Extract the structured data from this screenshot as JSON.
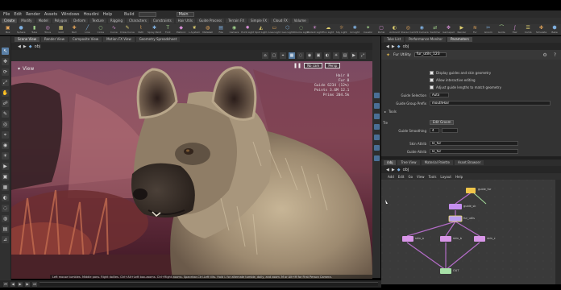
{
  "menubar": {
    "items": [
      "File",
      "Edit",
      "Render",
      "Assets",
      "Windows",
      "Houdini",
      "Help"
    ],
    "build_label": "Build",
    "main_label": "Main"
  },
  "shelf_tabs": [
    "Create",
    "Modify",
    "Model",
    "Polygon",
    "Deform",
    "Texture",
    "Rigging",
    "Characters",
    "Constraints",
    "Hair Utils",
    "Guide Process",
    "Terrain FX",
    "Simple FX",
    "Cloud FX",
    "Volume"
  ],
  "shelf_tools": [
    {
      "icon": "box-icon",
      "glyph": "▣",
      "label": "Box"
    },
    {
      "icon": "sphere-icon",
      "glyph": "●",
      "label": "Sphere"
    },
    {
      "icon": "tube-icon",
      "glyph": "▮",
      "label": "Tube"
    },
    {
      "icon": "torus-icon",
      "glyph": "◎",
      "label": "Torus"
    },
    {
      "icon": "grid-icon",
      "glyph": "▦",
      "label": "Grid"
    },
    {
      "icon": "null-icon",
      "glyph": "✚",
      "label": "Null"
    },
    {
      "icon": "line-icon",
      "glyph": "╱",
      "label": "Line"
    },
    {
      "icon": "circle-icon",
      "glyph": "○",
      "label": "Circle"
    },
    {
      "icon": "curve-icon",
      "glyph": "∿",
      "label": "Curve"
    },
    {
      "icon": "draw-curve-icon",
      "glyph": "✎",
      "label": "Draw Curve"
    },
    {
      "icon": "path-icon",
      "glyph": "⌇",
      "label": "Path"
    },
    {
      "icon": "spray-paint-icon",
      "glyph": "✱",
      "label": "Spray Paint"
    },
    {
      "icon": "font-icon",
      "glyph": "T",
      "label": "Font"
    },
    {
      "icon": "platonic-icon",
      "glyph": "◆",
      "label": "Platonic"
    },
    {
      "icon": "l-system-icon",
      "glyph": "❦",
      "label": "L-System"
    },
    {
      "icon": "metaball-icon",
      "glyph": "◍",
      "label": "Metaball"
    },
    {
      "icon": "file-icon",
      "glyph": "▤",
      "label": "File"
    },
    {
      "icon": "camera-icon",
      "glyph": "◉",
      "label": "Camera"
    },
    {
      "icon": "point-light-icon",
      "glyph": "✹",
      "label": "Point Light"
    },
    {
      "icon": "spot-light-icon",
      "glyph": "◭",
      "label": "Spot Light"
    },
    {
      "icon": "area-light-icon",
      "glyph": "▭",
      "label": "Area Light"
    },
    {
      "icon": "geometry-light-icon",
      "glyph": "⬡",
      "label": "Geo Light"
    },
    {
      "icon": "volume-light-icon",
      "glyph": "◌",
      "label": "Volume Light"
    },
    {
      "icon": "distant-light-icon",
      "glyph": "☀",
      "label": "Distant Light"
    },
    {
      "icon": "environment-light-icon",
      "glyph": "☁",
      "label": "Env Light"
    },
    {
      "icon": "sky-light-icon",
      "glyph": "☼",
      "label": "Sky Light"
    },
    {
      "icon": "gi-light-icon",
      "glyph": "✺",
      "label": "GI Light"
    },
    {
      "icon": "caustic-light-icon",
      "glyph": "✦",
      "label": "Caustic"
    },
    {
      "icon": "portal-light-icon",
      "glyph": "▢",
      "label": "Portal"
    },
    {
      "icon": "ambient-light-icon",
      "glyph": "◐",
      "label": "Ambient"
    },
    {
      "icon": "stereo-camera-icon",
      "glyph": "◎",
      "label": "Stereo Cam"
    },
    {
      "icon": "vr-camera-icon",
      "glyph": "◉",
      "label": "VR Camera"
    },
    {
      "icon": "switcher-icon",
      "glyph": "⇄",
      "label": "Switcher"
    },
    {
      "icon": "gamepad-camera-icon",
      "glyph": "✥",
      "label": "Gamepad"
    },
    {
      "icon": "render-icon",
      "glyph": "▶",
      "label": "Render"
    },
    {
      "icon": "fur-icon",
      "glyph": "≋",
      "label": "Fur"
    },
    {
      "icon": "groom-icon",
      "glyph": "✂",
      "label": "Groom"
    },
    {
      "icon": "guide-icon",
      "glyph": "⌒",
      "label": "Guide"
    },
    {
      "icon": "hair-icon",
      "glyph": "∫",
      "label": "Hair"
    },
    {
      "icon": "comb-icon",
      "glyph": "☰",
      "label": "Comb"
    },
    {
      "icon": "sim-icon",
      "glyph": "✤",
      "label": "Simulate"
    },
    {
      "icon": "bake-icon",
      "glyph": "⬢",
      "label": "Bake"
    }
  ],
  "left_tools": [
    "select-icon",
    "move-icon",
    "rotate-icon",
    "scale-icon",
    "handle-icon",
    "pose-icon",
    "brush-icon",
    "view-icon",
    "snap-icon",
    "camera-icon",
    "light-icon",
    "render-icon",
    "display-icon",
    "wire-icon",
    "shade-icon",
    "ghost-icon",
    "isolate-icon",
    "grid-icon",
    "measure-icon"
  ],
  "viewport": {
    "tabs": [
      "Scene View",
      "Render View",
      "Composite View",
      "Motion FX View",
      "Geometry Spreadsheet"
    ],
    "path_obj": "obj",
    "label": "View",
    "toolbar_icons": [
      "home-icon",
      "frame-icon",
      "snap-icon",
      "grid-icon",
      "ghost-icon",
      "camera-icon",
      "display-icon",
      "shading-icon",
      "light-icon",
      "wire-icon",
      "render-icon",
      "expand-icon"
    ],
    "camera_button": "No cam",
    "persp_button": "Persp",
    "stats": [
      "Hair 0",
      "Fur 0",
      "Guide 6234 (12%)",
      "Points 3.6M 12.1",
      "Prims 204.5k"
    ],
    "bottom_text": "Left mouse tumbles. Middle pans. Right dollies. Ctrl+Alt+Left box-zooms. Ctrl+Right zooms. Spacebar-Ctrl-Left tilts. Hold L for alternate tumble, dolly, and zoom.  M or Alt+M for First Person Camera."
  },
  "params": {
    "tabs": [
      "Take List",
      "Performance Monitor",
      "Parameters"
    ],
    "path_obj": "obj",
    "node_type": "Fur Utility",
    "node_name": "fur_utils_123",
    "rows": [
      {
        "type": "check",
        "text": "Display guides and skin geometry"
      },
      {
        "type": "check",
        "text": "Allow interactive editing"
      },
      {
        "type": "check",
        "text": "Adjust guide lengths to match geometry"
      },
      {
        "type": "field",
        "label": "Guide Selection",
        "value": "Auto"
      },
      {
        "type": "field",
        "label": "Guide Group Prefix",
        "value": "mouthHair"
      },
      {
        "type": "section",
        "text": "Tools"
      },
      {
        "type": "button",
        "label": "Tie",
        "value": "Edit Groom"
      },
      {
        "type": "field",
        "label": "Guide Smoothing",
        "value": "4"
      },
      {
        "type": "field",
        "label": "Skin Attrib",
        "value": "le_fur"
      },
      {
        "type": "field",
        "label": "Guide Attrib",
        "value": "le_fur"
      }
    ]
  },
  "network": {
    "tabs": [
      "/obj",
      "Tree View",
      "Material Palette",
      "Asset Browser"
    ],
    "path_obj": "obj",
    "menu": [
      "Add",
      "Edit",
      "Go",
      "View",
      "Tools",
      "Layout",
      "Help"
    ],
    "nodes": [
      {
        "id": "n1",
        "label": "guide_fur",
        "color": "#f0c64a"
      },
      {
        "id": "n2",
        "label": "guide_sk",
        "color": "#c58ef0"
      },
      {
        "id": "n3",
        "label": "fur_utils",
        "color": "#b99ef0"
      },
      {
        "id": "n4",
        "label": "skin_a",
        "color": "#d896e8"
      },
      {
        "id": "n5",
        "label": "skin_b",
        "color": "#d896e8"
      },
      {
        "id": "n6",
        "label": "skin_c",
        "color": "#d896e8"
      },
      {
        "id": "n7",
        "label": "OUT",
        "color": "#a7e0a7"
      }
    ]
  },
  "timeline": {
    "buttons": [
      "skip-start-icon",
      "prev-frame-icon",
      "play-icon",
      "next-frame-icon",
      "skip-end-icon"
    ]
  },
  "colors": {
    "accent": "#5a7fa6",
    "panel": "#333333",
    "network_bg": "#3a3a3a"
  }
}
